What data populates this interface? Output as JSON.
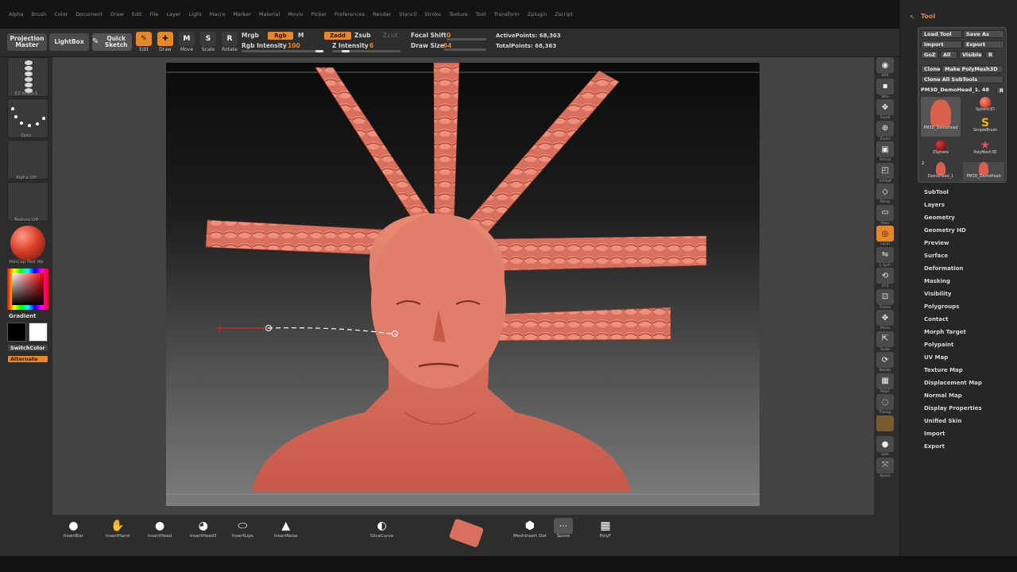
{
  "menus": [
    "Alpha",
    "Brush",
    "Color",
    "Document",
    "Draw",
    "Edit",
    "File",
    "Layer",
    "Light",
    "Macro",
    "Marker",
    "Material",
    "Movie",
    "Picker",
    "Preferences",
    "Render",
    "Stencil",
    "Stroke",
    "Texture",
    "Tool",
    "Transform",
    "Zplugin",
    "Zscript"
  ],
  "toolbar": {
    "projection_master": "Projection Master",
    "lightbox": "LightBox",
    "quick_sketch": "Quick Sketch",
    "edit": "Edit",
    "draw": "Draw",
    "move": "Move",
    "scale": "Scale",
    "rotate": "Rotate",
    "mrgb": "Mrgb",
    "rgb": "Rgb",
    "m": "M",
    "rgb_intensity_label": "Rgb Intensity",
    "rgb_intensity_value": "100",
    "zadd": "Zadd",
    "zsub": "Zsub",
    "zcut": "Zcut",
    "z_intensity_label": "Z Intensity",
    "z_intensity_value": "6",
    "focal_shift_label": "Focal Shift",
    "focal_shift_value": "0",
    "draw_size_label": "Draw Size",
    "draw_size_value": "64",
    "active_points": "ActivePoints: 68,363",
    "total_points": "TotalPoints: 68,363"
  },
  "left_shelf": {
    "brush_label": "EZ-braid-1",
    "stroke_label": "Dots",
    "alpha_label": "Alpha Off",
    "texture_label": "Texture Off",
    "material_label": "MatCap Red Wa",
    "gradient_label": "Gradient",
    "switch_color": "SwitchColor",
    "alternate": "Alternate"
  },
  "right_shelf": [
    {
      "icon": "bpr-icon",
      "label": "BPR"
    },
    {
      "icon": "spix-icon",
      "label": "SPix"
    },
    {
      "icon": "scroll-icon",
      "label": "Scroll"
    },
    {
      "icon": "zoom-icon",
      "label": "Zoom"
    },
    {
      "icon": "actual-icon",
      "label": "Actual"
    },
    {
      "icon": "aahalf-icon",
      "label": "AAHalf"
    },
    {
      "icon": "persp-icon",
      "label": "Persp"
    },
    {
      "icon": "floor-icon",
      "label": "Floor"
    },
    {
      "icon": "local-icon",
      "label": "Local"
    },
    {
      "icon": "lsym-icon",
      "label": "L.Sym"
    },
    {
      "icon": "xyz-icon",
      "label": "XYZ"
    },
    {
      "icon": "frame-icon",
      "label": "Frame"
    },
    {
      "icon": "move-icon",
      "label": "Move"
    },
    {
      "icon": "scale-icon",
      "label": "Scale"
    },
    {
      "icon": "rotate-icon",
      "label": "Rotate"
    },
    {
      "icon": "polyf-icon",
      "label": "PolyF"
    },
    {
      "icon": "transp-icon",
      "label": "Transp"
    },
    {
      "icon": "dynamic-icon",
      "label": ""
    },
    {
      "icon": "solo-icon",
      "label": "Solo"
    },
    {
      "icon": "xpose-icon",
      "label": "Xpose"
    }
  ],
  "tool_panel": {
    "title": "Tool",
    "load_tool": "Load Tool",
    "save_as": "Save As",
    "import": "Import",
    "export": "Export",
    "goz": "GoZ",
    "all": "All",
    "visible": "Visible",
    "r": "R",
    "clone": "Clone",
    "make_polymesh": "Make PolyMesh3D",
    "clone_all_subtools": "Clone All SubTools",
    "current_tool": "PM3D_DemoHead_1. 48",
    "tools": [
      {
        "name": "PM3D_DemoHead"
      },
      {
        "name": "Sphere3D"
      },
      {
        "name": "SimpleBrush"
      },
      {
        "name": "ZSphere"
      },
      {
        "name": "PolyMesh3D"
      },
      {
        "name": "DemoHead_1"
      },
      {
        "name": "PM3D_DemoHead"
      }
    ],
    "count_badge": "2",
    "menu": [
      "SubTool",
      "Layers",
      "Geometry",
      "Geometry HD",
      "Preview",
      "Surface",
      "Deformation",
      "Masking",
      "Visibility",
      "Polygroups",
      "Contact",
      "Morph Target",
      "Polypaint",
      "UV Map",
      "Texture Map",
      "Displacement Map",
      "Normal Map",
      "Display Properties",
      "Unified Skin",
      "Import",
      "Export"
    ]
  },
  "bottom_shelf": {
    "items": [
      "InsertEar",
      "InsertHand",
      "InsertHead",
      "InsertHead3",
      "InsertLips",
      "InsertNose"
    ],
    "slice_curve": "SliceCurve",
    "mesh_insert_dot": "MeshInsert Dot",
    "spose": "Spose",
    "polyf": "PolyF"
  },
  "colors": {
    "accent": "#e8872a",
    "sculpt": "#e47a66",
    "bg": "#2d2d2d"
  }
}
